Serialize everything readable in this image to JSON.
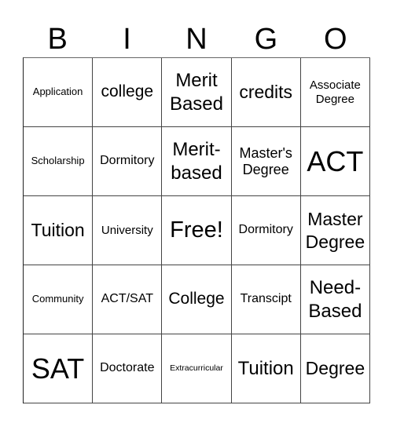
{
  "header": [
    "B",
    "I",
    "N",
    "G",
    "O"
  ],
  "cells": [
    [
      "Application",
      "college",
      "Merit Based",
      "credits",
      "Associate Degree"
    ],
    [
      "Scholarship",
      "Dormitory",
      "Merit-based",
      "Master's Degree",
      "ACT"
    ],
    [
      "Tuition",
      "University",
      "Free!",
      "Dormitory",
      "Master Degree"
    ],
    [
      "Community",
      "ACT/SAT",
      "College",
      "Transcipt",
      "Need-Based"
    ],
    [
      "SAT",
      "Doctorate",
      "Extracurricular",
      "Tuition",
      "Degree"
    ]
  ]
}
